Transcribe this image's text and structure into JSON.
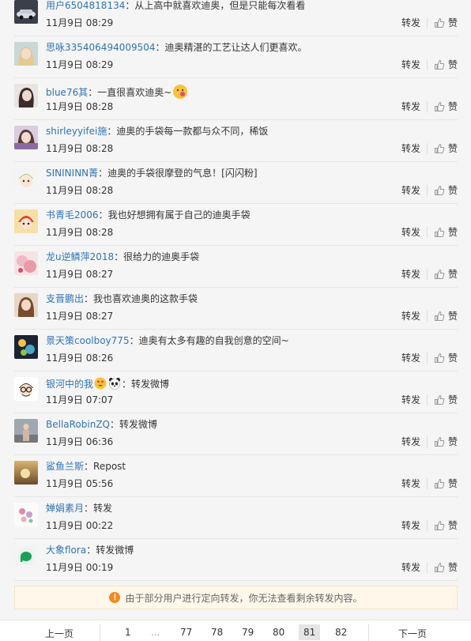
{
  "reposts": [
    {
      "user": "用户6504818134",
      "text": "从上高中就喜欢迪奥，但是只能每次看看",
      "time": "11月9日 08:29",
      "avatar": "car"
    },
    {
      "user": "思咏335406494009504",
      "text": "迪奥精湛的工艺让达人们更喜欢。",
      "time": "11月9日 08:29",
      "avatar": "girl-blonde"
    },
    {
      "user": "blue76其",
      "text": "一直很喜欢迪奥~",
      "time": "11月9日 08:28",
      "avatar": "girl-dark",
      "emoji_after": "kiss-emoji"
    },
    {
      "user": "shirleyyifei施",
      "text": "迪奥的手袋每一款都与众不同，稀饭",
      "time": "11月9日 08:28",
      "avatar": "girl-purple"
    },
    {
      "user": "SINININN菁",
      "text": "迪奥的手袋很摩登的气息！[闪闪粉]",
      "time": "11月9日 08:28",
      "avatar": "cartoon-green"
    },
    {
      "user": "书青毛2006",
      "text": "我也好想拥有属于自己的迪奥手袋",
      "time": "11月9日 08:28",
      "avatar": "cartoon-red"
    },
    {
      "user": "龙u逆鳞萍2018",
      "text": "很给力的迪奥手袋",
      "time": "11月9日 08:27",
      "avatar": "pink-soft"
    },
    {
      "user": "支晋鹏出",
      "text": "我也喜欢迪奥的这款手袋",
      "time": "11月9日 08:27",
      "avatar": "girl-brown"
    },
    {
      "user": "景天策coolboy775",
      "text": "迪奥有太多有趣的自我创意的空间~",
      "time": "11月9日 08:26",
      "avatar": "night-color"
    },
    {
      "user": "银河中的我",
      "text": "转发微博",
      "time": "11月9日 07:07",
      "avatar": "cartoon-glasses",
      "emoji_after_user": [
        "heart-eyes-emoji",
        "panda-emoji"
      ]
    },
    {
      "user": "BellaRobinZQ",
      "text": "转发微博",
      "time": "11月9日 06:36",
      "avatar": "girl-street"
    },
    {
      "user": "鲨鱼兰斯",
      "text": "Repost",
      "time": "11月9日 05:56",
      "avatar": "sunset"
    },
    {
      "user": "婵娟素月",
      "text": "转发",
      "time": "11月9日 00:22",
      "avatar": "flowers"
    },
    {
      "user": "大象flora",
      "text": "转发微博",
      "time": "11月9日 00:19",
      "avatar": "elephant"
    }
  ],
  "actions": {
    "repost_label": "转发",
    "like_label": "赞"
  },
  "notice": {
    "text": "由于部分用户进行定向转发，你无法查看剩余转发内容。",
    "icon": "warning-icon"
  },
  "pager": {
    "prev_label": "上一页",
    "next_label": "下一页",
    "pages": [
      "1",
      "...",
      "77",
      "78",
      "79",
      "80",
      "81",
      "82"
    ],
    "current": "81"
  }
}
